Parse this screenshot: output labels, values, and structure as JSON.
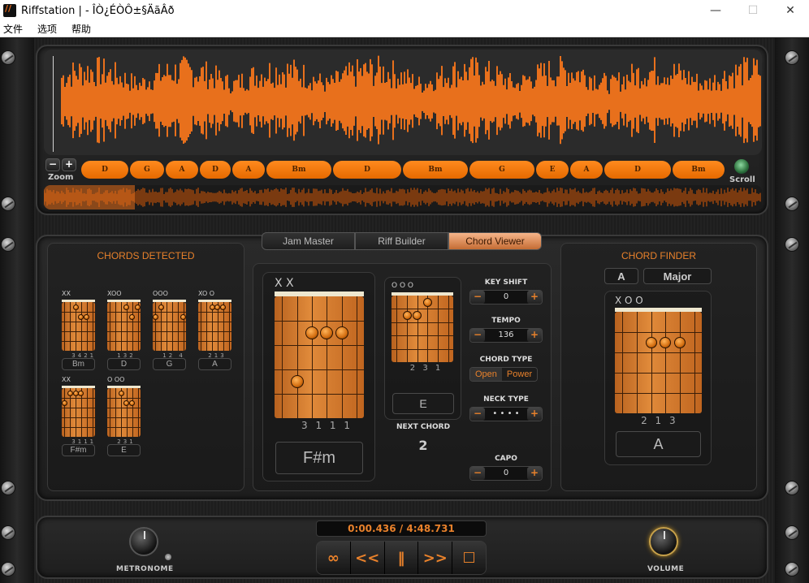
{
  "window": {
    "title": "Riffstation |  - ÎÒ¿ÉÒÔ±§ÄãÂð",
    "minimize": "—",
    "maximize": "☐",
    "close": "✕"
  },
  "menu": [
    "文件",
    "选项",
    "帮助"
  ],
  "waveform": {
    "accent": "#e8701c",
    "zoom_minus": "−",
    "zoom_plus": "+",
    "zoom_label": "Zoom",
    "scroll_label": "Scroll"
  },
  "chord_lane": [
    {
      "label": "D",
      "start": 0,
      "width": 58
    },
    {
      "label": "G",
      "start": 60,
      "width": 42
    },
    {
      "label": "A",
      "start": 104,
      "width": 40
    },
    {
      "label": "D",
      "start": 146,
      "width": 38
    },
    {
      "label": "A",
      "start": 186,
      "width": 40
    },
    {
      "label": "Bm",
      "start": 228,
      "width": 80
    },
    {
      "label": "D",
      "start": 310,
      "width": 84
    },
    {
      "label": "Bm",
      "start": 396,
      "width": 80
    },
    {
      "label": "G",
      "start": 478,
      "width": 80
    },
    {
      "label": "E",
      "start": 560,
      "width": 40
    },
    {
      "label": "A",
      "start": 602,
      "width": 40
    },
    {
      "label": "D",
      "start": 644,
      "width": 82
    },
    {
      "label": "Bm",
      "start": 728,
      "width": 64
    }
  ],
  "tabs": [
    {
      "label": "Jam Master",
      "active": false
    },
    {
      "label": "Riff Builder",
      "active": false
    },
    {
      "label": "Chord Viewer",
      "active": true
    }
  ],
  "chords_detected": {
    "title": "CHORDS DETECTED",
    "items": [
      {
        "name": "Bm",
        "marks": "XX",
        "fingers": "3421"
      },
      {
        "name": "D",
        "marks": "XOO",
        "fingers": "132"
      },
      {
        "name": "G",
        "marks": "OOO",
        "fingers": "12    4"
      },
      {
        "name": "A",
        "marks": "XO      O",
        "fingers": "213"
      },
      {
        "name": "F#m",
        "marks": "XX",
        "fingers": "3111"
      },
      {
        "name": "E",
        "marks": "O      OO",
        "fingers": "231"
      }
    ]
  },
  "current_chord": {
    "name": "F#m",
    "marks": "X X",
    "fingers": "3 1 1 1"
  },
  "next_chord": {
    "name": "E",
    "marks": "O           O O",
    "fingers": "2 3 1",
    "label": "NEXT CHORD",
    "count": "2"
  },
  "controls": {
    "key_shift": {
      "label": "KEY SHIFT",
      "value": "0"
    },
    "tempo": {
      "label": "TEMPO",
      "value": "136"
    },
    "chord_type": {
      "label": "CHORD TYPE",
      "open": "Open",
      "power": "Power"
    },
    "neck_type": {
      "label": "NECK TYPE",
      "value": "• • • •"
    },
    "capo": {
      "label": "CAPO",
      "value": "0"
    },
    "minus": "−",
    "plus": "+"
  },
  "chord_finder": {
    "title": "CHORD FINDER",
    "root": "A",
    "quality": "Major",
    "marks": "X O               O",
    "fingers": "2 1 3",
    "name": "A"
  },
  "transport": {
    "time": "0:00.436 / 4:48.731",
    "loop": "∞",
    "rewind": "<<",
    "pause": "‖",
    "forward": ">>",
    "stop": "☐"
  },
  "knobs": {
    "metronome": "METRONOME",
    "volume": "VOLUME"
  }
}
